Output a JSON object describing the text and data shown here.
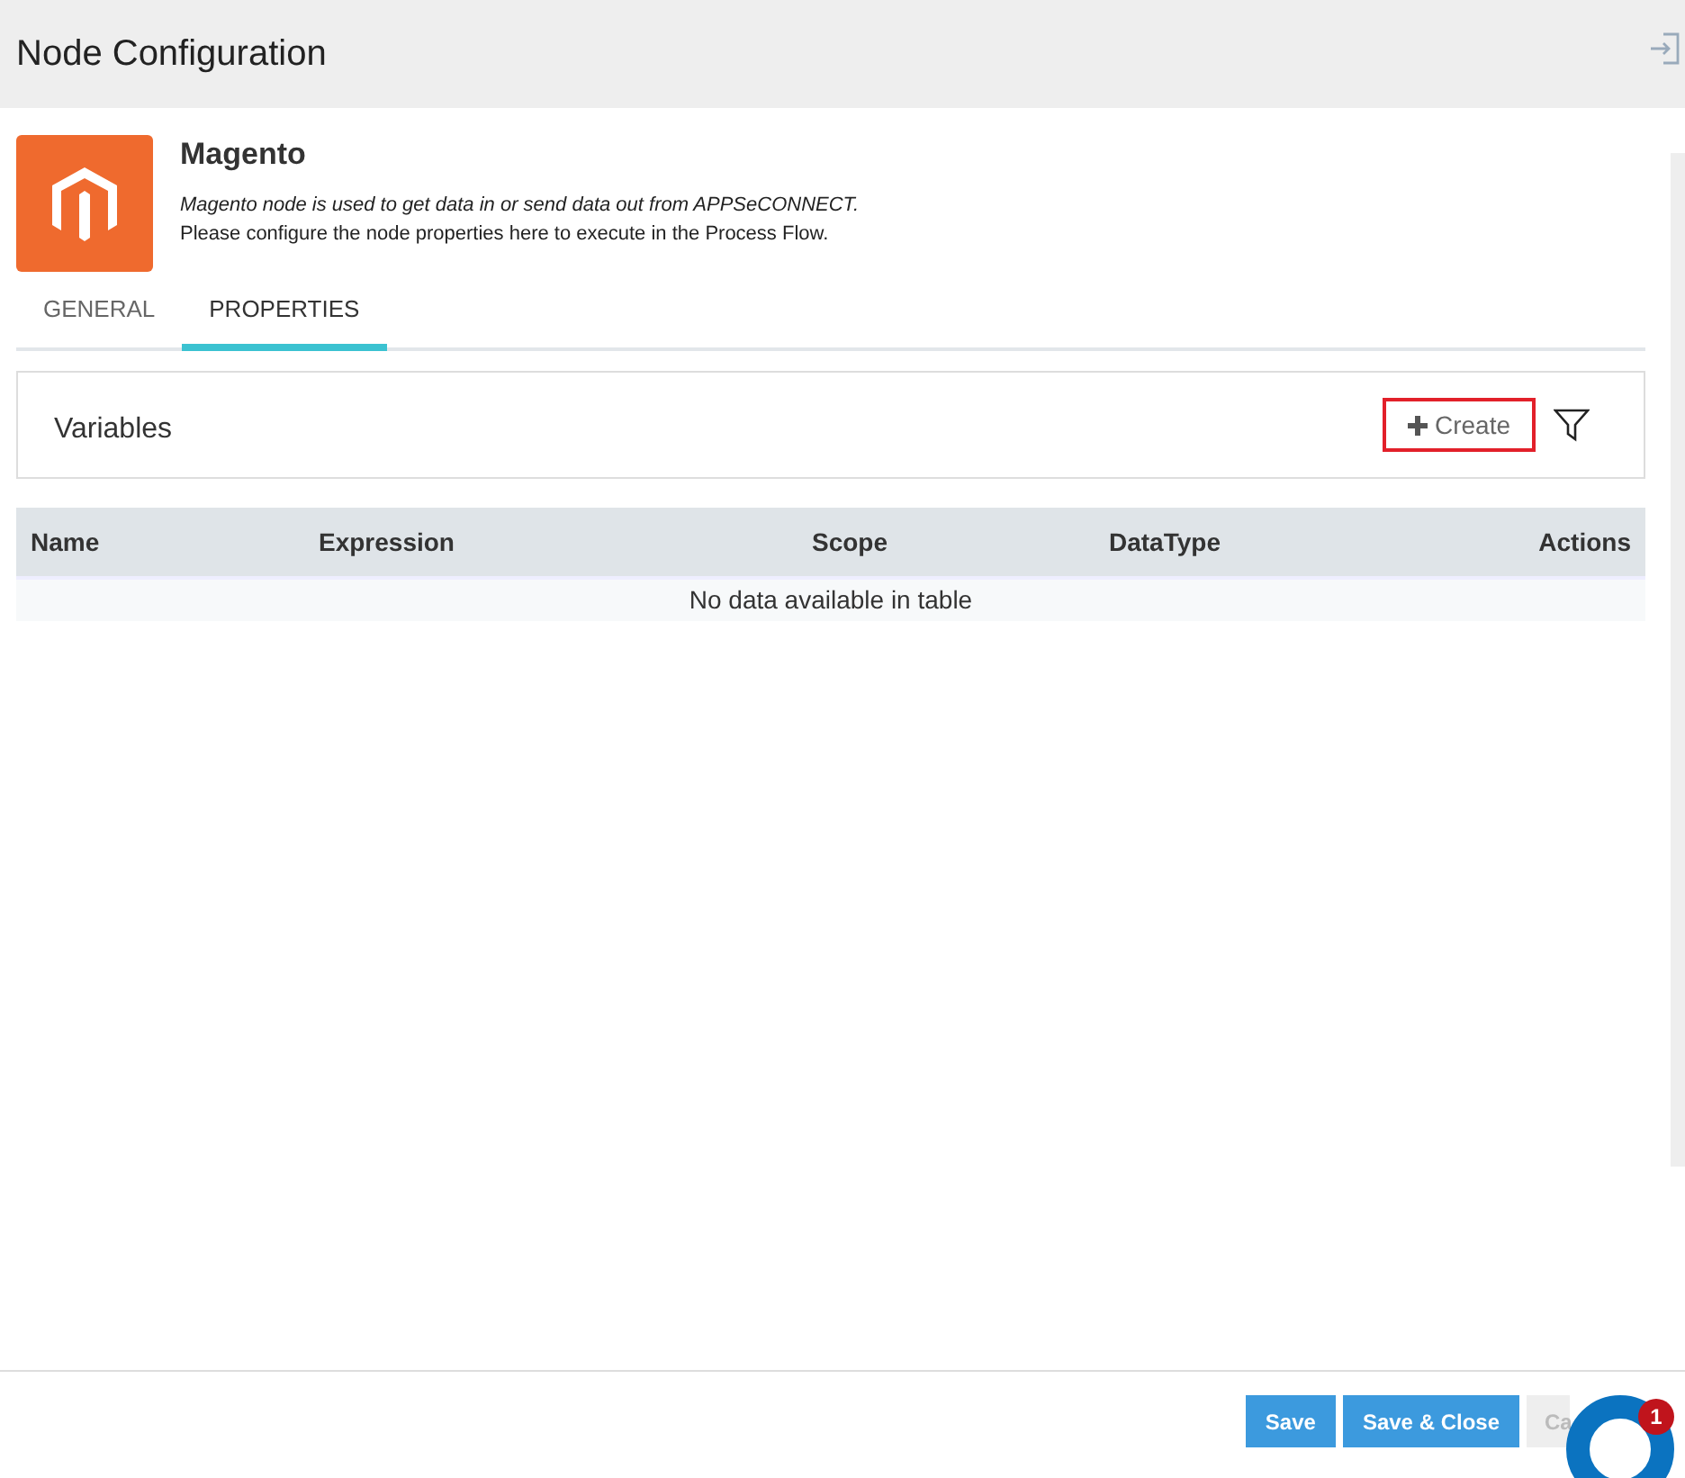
{
  "window": {
    "title": "Node Configuration"
  },
  "node": {
    "name": "Magento",
    "description": "Magento node is used to get data in or send data out from APPSeCONNECT.",
    "instruction": "Please configure the node properties here to execute in the Process Flow."
  },
  "tabs": [
    {
      "label": "GENERAL",
      "selected": false
    },
    {
      "label": "PROPERTIES",
      "selected": true
    }
  ],
  "panel": {
    "title": "Variables",
    "create_button": "Create",
    "create_highlighted": true
  },
  "table": {
    "columns": [
      "Name",
      "Expression",
      "Scope",
      "DataType",
      "Actions"
    ],
    "empty_message": "No data available in table"
  },
  "buttons": [
    {
      "label": "Save",
      "kind": "primary"
    },
    {
      "label": "Save & Close",
      "kind": "primary"
    },
    {
      "label": "Ca",
      "kind": "secondary"
    }
  ],
  "chat": {
    "badge": "1"
  }
}
